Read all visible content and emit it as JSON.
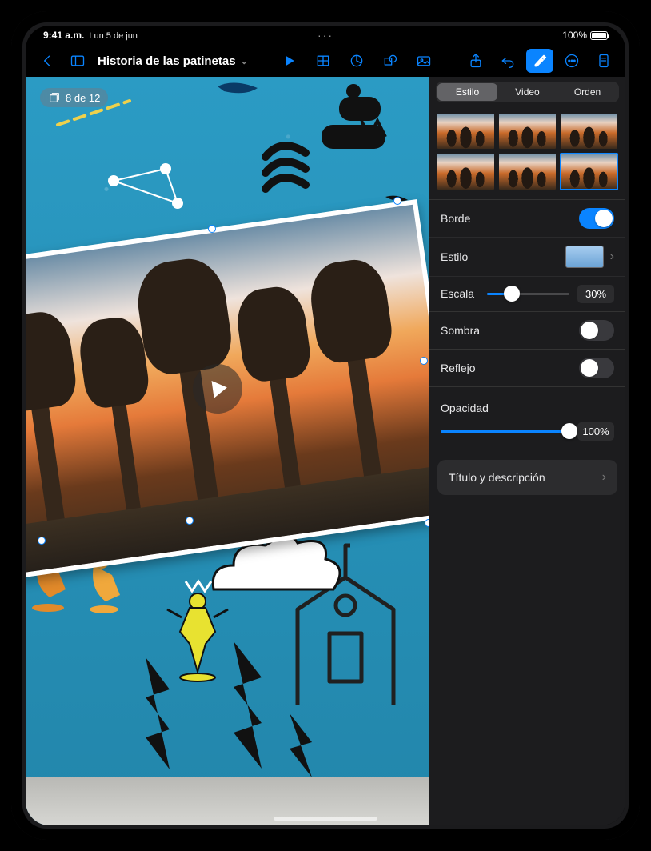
{
  "status": {
    "time": "9:41 a.m.",
    "date": "Lun 5 de jun",
    "battery_pct": "100%"
  },
  "toolbar": {
    "doc_title": "Historia de las patinetas"
  },
  "canvas": {
    "slide_count_label": "8 de 12"
  },
  "inspector": {
    "tabs": {
      "style": "Estilo",
      "video": "Video",
      "order": "Orden"
    },
    "border": {
      "label": "Borde",
      "on": true,
      "style_label": "Estilo",
      "scale_label": "Escala",
      "scale_pct": "30%",
      "scale_value": 30
    },
    "shadow": {
      "label": "Sombra",
      "on": false
    },
    "reflection": {
      "label": "Reflejo",
      "on": false
    },
    "opacity": {
      "label": "Opacidad",
      "pct": "100%",
      "value": 100
    },
    "title_desc": {
      "label": "Título y descripción"
    }
  }
}
